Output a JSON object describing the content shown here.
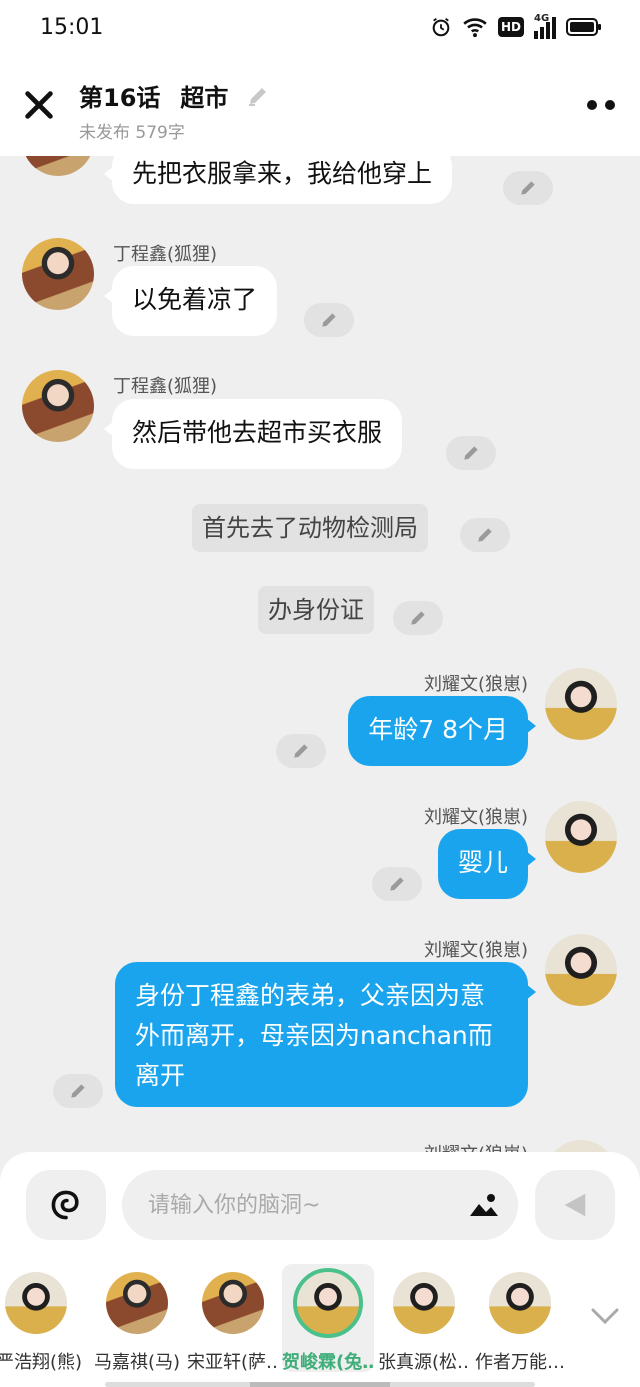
{
  "status_bar": {
    "time": "15:01",
    "network": "4G",
    "hd": "HD"
  },
  "header": {
    "chapter": "第16话",
    "title": "超市",
    "subtitle": "未发布 579字"
  },
  "messages": [
    {
      "type": "left",
      "name": "",
      "text": "先把衣服拿来，我给他穿上"
    },
    {
      "type": "left",
      "name": "丁程鑫(狐狸)",
      "text": "以免着凉了"
    },
    {
      "type": "left",
      "name": "丁程鑫(狐狸)",
      "text": "然后带他去超市买衣服"
    },
    {
      "type": "narration",
      "text": "首先去了动物检测局"
    },
    {
      "type": "narration",
      "text": "办身份证"
    },
    {
      "type": "right",
      "name": "刘耀文(狼崽)",
      "text": "年龄7 8个月"
    },
    {
      "type": "right",
      "name": "刘耀文(狼崽)",
      "text": "婴儿"
    },
    {
      "type": "right",
      "name": "刘耀文(狼崽)",
      "text": "身份丁程鑫的表弟，父亲因为意外而离开，母亲因为nanchan而离开"
    },
    {
      "type": "right",
      "name": "刘耀文(狼崽)",
      "text": ""
    }
  ],
  "input": {
    "placeholder": "请输入你的脑洞~"
  },
  "characters": [
    {
      "name": "严浩翔(熊)",
      "selected": false
    },
    {
      "name": "马嘉祺(马)",
      "selected": false
    },
    {
      "name": "宋亚轩(萨…",
      "selected": false
    },
    {
      "name": "贺峻霖(兔…",
      "selected": true
    },
    {
      "name": "张真源(松…",
      "selected": false
    },
    {
      "name": "作者万能…",
      "selected": false
    }
  ],
  "colors": {
    "accent": "#1aa4ee",
    "selected": "#4ac18a"
  }
}
